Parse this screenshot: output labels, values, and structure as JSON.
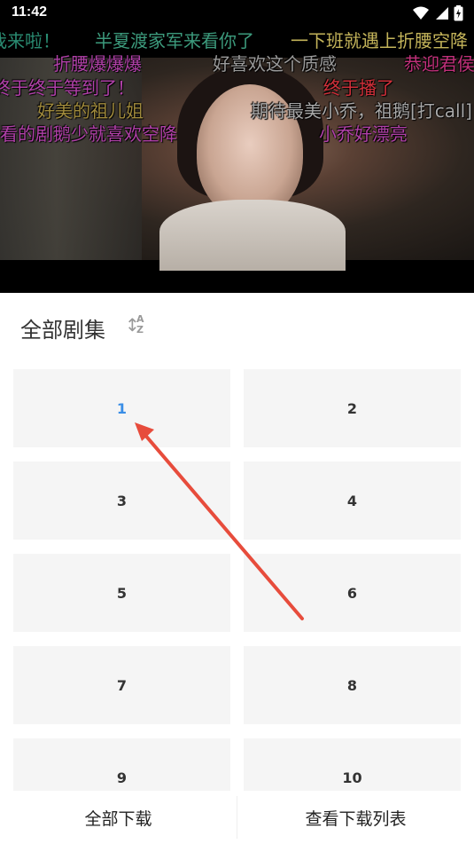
{
  "status_bar": {
    "time": "11:42"
  },
  "danmaku": [
    {
      "text": "我来啦！",
      "color": "#2a8c72"
    },
    {
      "text": "半夏渡家军来看你了",
      "color": "#3c9a7c"
    },
    {
      "text": "一下班就遇上折腰空降",
      "color": "#c4b45a"
    },
    {
      "text": "折腰爆爆爆",
      "color": "#b040a8"
    },
    {
      "text": "好喜欢这个质感",
      "color": "#9a9a9a"
    },
    {
      "text": "恭迎君侯",
      "color": "#c0307a"
    },
    {
      "text": "终于终于等到了！",
      "color": "#b040a8"
    },
    {
      "text": "终于播了",
      "color": "#d0303a"
    },
    {
      "text": "好美的祖儿姐",
      "color": "#a08a3c"
    },
    {
      "text": "期待最美小乔，祖鹅[打call]",
      "color": "#a8a8a8"
    },
    {
      "text": "看的剧鹅少就喜欢空降",
      "color": "#b040a8"
    },
    {
      "text": "小乔好漂亮",
      "color": "#b040a8"
    }
  ],
  "panel": {
    "title": "全部剧集",
    "sort_icon": "sort-az-icon",
    "episodes": [
      "1",
      "2",
      "3",
      "4",
      "5",
      "6",
      "7",
      "8",
      "9",
      "10"
    ],
    "active_episode": "1",
    "accent_color": "#3a8ee6"
  },
  "bottom_bar": {
    "download_all": "全部下载",
    "view_download_list": "查看下载列表"
  }
}
